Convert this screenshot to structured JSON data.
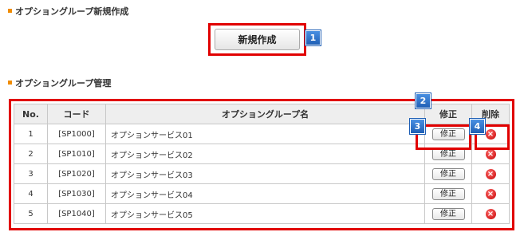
{
  "section_create": {
    "title": "オプショングループ新規作成"
  },
  "create_button": {
    "label": "新規作成"
  },
  "section_manage": {
    "title": "オプショングループ管理"
  },
  "table": {
    "headers": [
      "No.",
      "コード",
      "オプショングループ名",
      "修正",
      "削除"
    ],
    "rows": [
      {
        "no": "1",
        "code": "[SP1000]",
        "name": "オプションサービス01",
        "edit": "修正",
        "delete_icon": "delete-icon"
      },
      {
        "no": "2",
        "code": "[SP1010]",
        "name": "オプションサービス02",
        "edit": "修正",
        "delete_icon": "delete-icon"
      },
      {
        "no": "3",
        "code": "[SP1020]",
        "name": "オプションサービス03",
        "edit": "修正",
        "delete_icon": "delete-icon"
      },
      {
        "no": "4",
        "code": "[SP1030]",
        "name": "オプションサービス04",
        "edit": "修正",
        "delete_icon": "delete-icon"
      },
      {
        "no": "5",
        "code": "[SP1040]",
        "name": "オプションサービス05",
        "edit": "修正",
        "delete_icon": "delete-icon"
      }
    ]
  },
  "badges": [
    "1",
    "2",
    "3",
    "4"
  ],
  "colors": {
    "highlight": "#e10000",
    "badge": "#1f5fb5",
    "bullet": "#f08c00"
  }
}
